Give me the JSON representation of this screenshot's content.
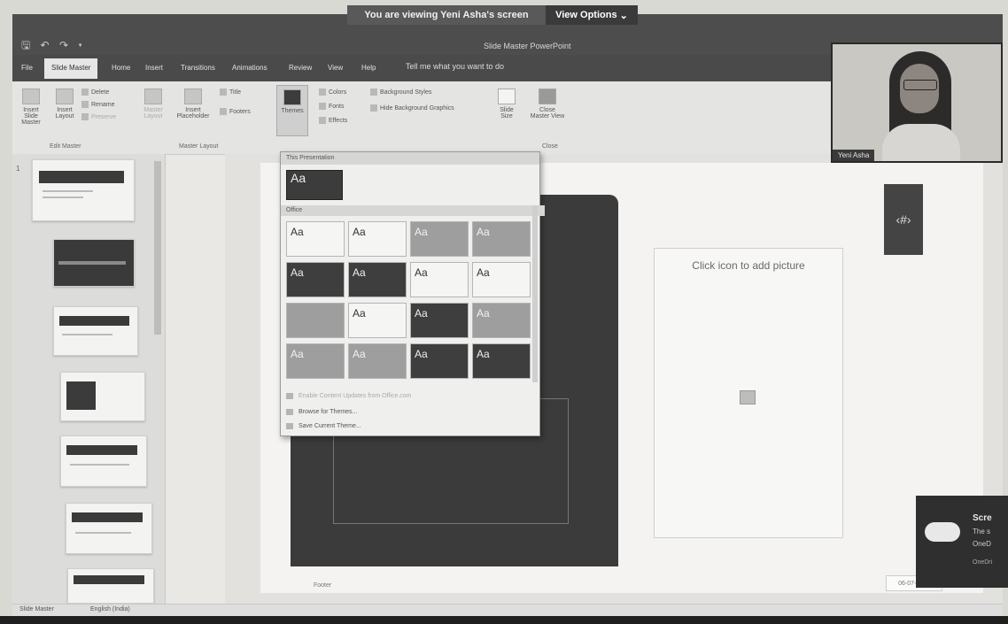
{
  "screen_share": {
    "banner_text": "You are viewing Yeni Asha's screen",
    "view_options_label": "View Options",
    "chevron": "⌄"
  },
  "titlebar": {
    "qat_icons": "🖫 ↶ ↷ ▾",
    "doc_title": "Slide Master  PowerPoint"
  },
  "tabs": {
    "file": "File",
    "slide_master": "Slide Master",
    "home": "Home",
    "insert": "Insert",
    "transitions": "Transitions",
    "animations": "Animations",
    "review": "Review",
    "view": "View",
    "help": "Help",
    "tell_me": "Tell me what you want to do"
  },
  "ribbon": {
    "insert_slide_master": "Insert Slide Master",
    "insert_layout": "Insert Layout",
    "delete": "Delete",
    "rename": "Rename",
    "preserve": "Preserve",
    "group_edit_master": "Edit Master",
    "master_layout": "Master Layout",
    "insert_placeholder": "Insert Placeholder",
    "title_cb": "Title",
    "footers_cb": "Footers",
    "group_master_layout": "Master Layout",
    "themes": "Themes",
    "colors": "Colors",
    "fonts": "Fonts",
    "effects": "Effects",
    "background_styles": "Background Styles",
    "hide_background": "Hide Background Graphics",
    "slide_size": "Slide Size",
    "close_master_view": "Close Master View",
    "group_close": "Close"
  },
  "gallery": {
    "header_this": "This Presentation",
    "current_label": "Aa",
    "header_office": "Office",
    "tile_label": "Aa",
    "browse": "Browse for Themes...",
    "save": "Save Current Theme...",
    "enable": "Enable Content Updates from Office.com"
  },
  "slide": {
    "picture_placeholder": "Click icon to add picture",
    "number_placeholder": "‹#›",
    "footer": "Footer",
    "date": "06-07-2020"
  },
  "status": {
    "view": "Slide Master",
    "lang": "English (India)"
  },
  "webcam": {
    "name": "Yeni Asha"
  },
  "toast": {
    "title": "Scre",
    "line1": "The s",
    "line2": "OneD",
    "source": "OneDri"
  }
}
